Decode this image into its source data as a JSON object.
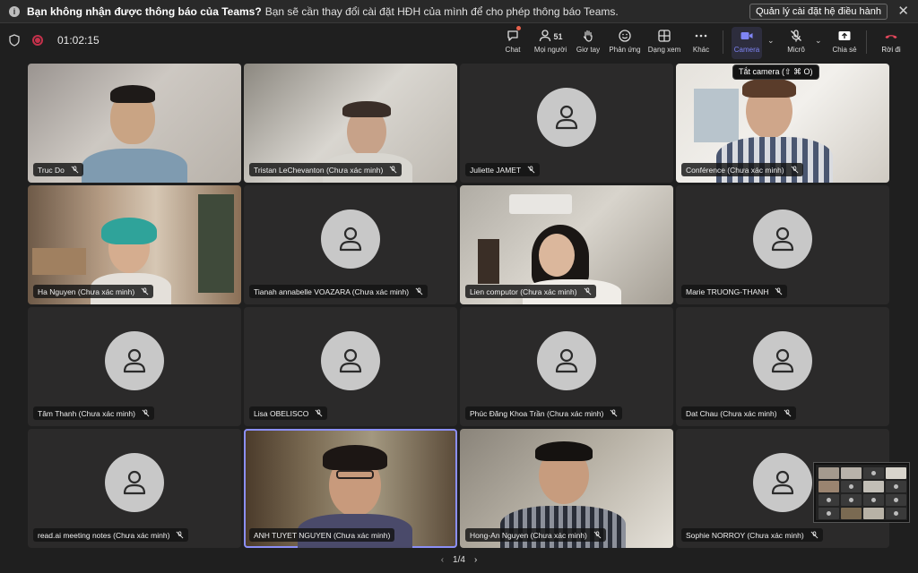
{
  "banner": {
    "info_icon": "i",
    "bold_text": "Bạn không nhận được thông báo của Teams?",
    "message": "Bạn sẽ cần thay đổi cài đặt HĐH của mình để cho phép thông báo Teams.",
    "manage_button": "Quản lý cài đặt hệ điều hành",
    "close_glyph": "✕"
  },
  "meeting": {
    "timer": "01:02:15"
  },
  "toolbar": {
    "chat": "Chat",
    "people_count": "51",
    "people": "Mọi người",
    "raise_hand": "Giơ tay",
    "react": "Phản ứng",
    "view": "Dạng xem",
    "more": "Khác",
    "camera": "Camera",
    "mic": "Micrô",
    "share": "Chia sẻ",
    "leave": "Rời đi",
    "chevron": "⌄"
  },
  "tooltip": {
    "camera_off": "Tắt camera (⇧ ⌘ O)"
  },
  "participants": [
    {
      "name": "Truc Do",
      "video": true
    },
    {
      "name": "Tristan LeChevanton (Chưa xác minh)",
      "video": true
    },
    {
      "name": "Juliette JAMET",
      "video": false
    },
    {
      "name": "Conférence (Chưa xác minh)",
      "video": true
    },
    {
      "name": "Ha Nguyen (Chưa xác minh)",
      "video": true
    },
    {
      "name": "Tianah annabelle VOAZARA (Chưa xác minh)",
      "video": false
    },
    {
      "name": "Lien computor (Chưa xác minh)",
      "video": true
    },
    {
      "name": "Marie TRUONG-THANH",
      "video": false
    },
    {
      "name": "Tâm Thanh (Chưa xác minh)",
      "video": false
    },
    {
      "name": "Lisa OBELISCO",
      "video": false
    },
    {
      "name": "Phúc Đăng Khoa Trần (Chưa xác minh)",
      "video": false
    },
    {
      "name": "Dat Chau (Chưa xác minh)",
      "video": false
    },
    {
      "name": "read.ai meeting notes (Chưa xác minh)",
      "video": false
    },
    {
      "name": "ANH TUYET NGUYEN (Chưa xác minh)",
      "video": true
    },
    {
      "name": "Hong-An Nguyen (Chưa xác minh)",
      "video": true
    },
    {
      "name": "Sophie NORROY (Chưa xác minh)",
      "video": false
    }
  ],
  "pagination": {
    "page": "1/4",
    "prev": "‹",
    "next": "›"
  },
  "colors": {
    "accent": "#7f85f5",
    "leave": "#c4314b",
    "record": "#c4314b",
    "background": "#1f1f1f"
  }
}
